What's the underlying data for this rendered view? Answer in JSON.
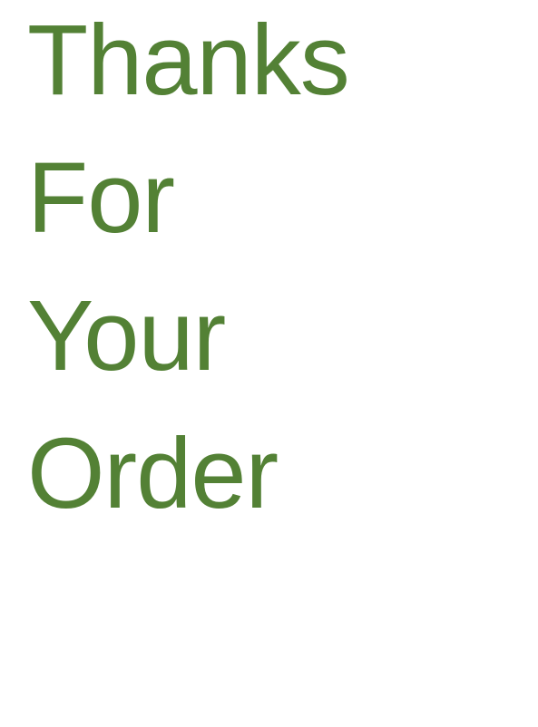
{
  "message": {
    "lines": [
      "Thanks",
      "For",
      "Your",
      "Order"
    ]
  },
  "colors": {
    "text": "#538135",
    "background": "#ffffff"
  }
}
